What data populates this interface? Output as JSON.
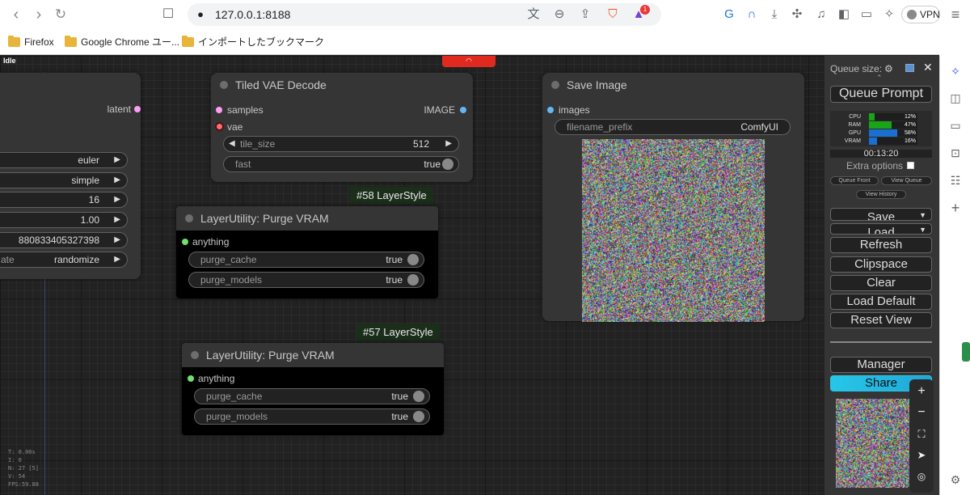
{
  "browser": {
    "url": "127.0.0.1:8188",
    "vpn_label": "VPN",
    "notification_count": "1",
    "bookmarks": [
      "Firefox",
      "Google Chrome ユー...",
      "インポートしたブックマーク"
    ]
  },
  "canvas": {
    "status": "Idle",
    "stats": [
      "T: 0.00s",
      "I: 0",
      "N: 27 [5]",
      "V: 54",
      "FPS:59.88"
    ]
  },
  "ksampler": {
    "output_label": "latent",
    "widgets": [
      {
        "label": "",
        "value": "euler"
      },
      {
        "label": "",
        "value": "simple"
      },
      {
        "label": "",
        "value": "16"
      },
      {
        "label": "",
        "value": "1.00"
      },
      {
        "label": "",
        "value": "880833405327398"
      },
      {
        "label": "ate",
        "value": "randomize"
      }
    ]
  },
  "tiled_vae": {
    "title": "Tiled VAE Decode",
    "inputs": [
      "samples",
      "vae"
    ],
    "output": "IMAGE",
    "tile_label": "tile_size",
    "tile_value": "512",
    "fast_label": "fast",
    "fast_value": "true"
  },
  "purge1": {
    "tag": "#58 LayerStyle",
    "title": "LayerUtility: Purge VRAM",
    "input": "anything",
    "cache_label": "purge_cache",
    "cache_value": "true",
    "models_label": "purge_models",
    "models_value": "true"
  },
  "purge2": {
    "tag": "#57 LayerStyle",
    "title": "LayerUtility: Purge VRAM",
    "input": "anything",
    "cache_label": "purge_cache",
    "cache_value": "true",
    "models_label": "purge_models",
    "models_value": "true"
  },
  "save_image": {
    "title": "Save Image",
    "input": "images",
    "prefix_label": "filename_prefix",
    "prefix_value": "ComfyUI"
  },
  "panel": {
    "queue_size": "Queue size:",
    "queue_prompt": "Queue Prompt",
    "usage": [
      {
        "label": "CPU",
        "percent": 12,
        "text": "12%",
        "color": "#18a518"
      },
      {
        "label": "RAM",
        "percent": 47,
        "text": "47%",
        "color": "#18a518"
      },
      {
        "label": "GPU",
        "percent": 58,
        "text": "58%",
        "color": "#1a6fd1"
      },
      {
        "label": "VRAM",
        "percent": 16,
        "text": "16%",
        "color": "#1a6fd1"
      }
    ],
    "timer": "00:13:20",
    "extra_options": "Extra options",
    "queue_front": "Queue Front",
    "view_queue": "View Queue",
    "view_history": "View History",
    "save": "Save",
    "load": "Load",
    "refresh": "Refresh",
    "clipspace": "Clipspace",
    "clear": "Clear",
    "load_default": "Load Default",
    "reset_view": "Reset View",
    "manager": "Manager",
    "share": "Share"
  }
}
